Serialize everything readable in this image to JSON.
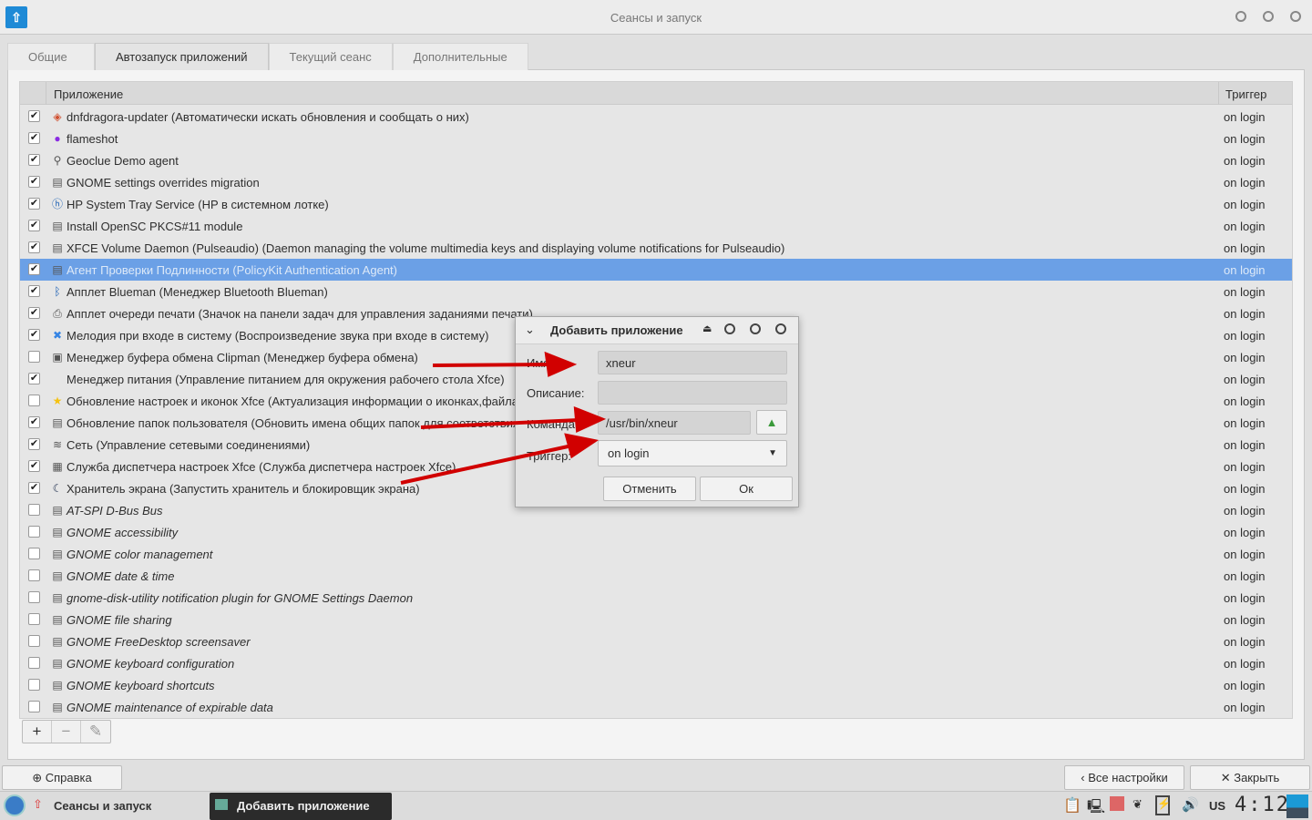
{
  "window": {
    "title": "Сеансы и запуск"
  },
  "tabs": [
    "Общие",
    "Автозапуск приложений",
    "Текущий сеанс",
    "Дополнительные"
  ],
  "table": {
    "headers": {
      "app": "Приложение",
      "trigger": "Триггер"
    },
    "rows": [
      {
        "checked": true,
        "icon": "dnfdragora-icon",
        "label": "dnfdragora-updater (Автоматически искать обновления и сообщать о них)",
        "trigger": "on login"
      },
      {
        "checked": true,
        "icon": "flameshot-icon",
        "label": "flameshot",
        "trigger": "on login"
      },
      {
        "checked": true,
        "icon": "location-pin-icon",
        "label": "Geoclue Demo agent",
        "trigger": "on login"
      },
      {
        "checked": true,
        "icon": "file-icon",
        "label": "GNOME settings overrides migration",
        "trigger": "on login"
      },
      {
        "checked": true,
        "icon": "hp-icon",
        "label": "HP System Tray Service (HP в системном лотке)",
        "trigger": "on login"
      },
      {
        "checked": true,
        "icon": "file-icon",
        "label": "Install OpenSC PKCS#11 module",
        "trigger": "on login"
      },
      {
        "checked": true,
        "icon": "file-icon",
        "label": "XFCE Volume Daemon (Pulseaudio) (Daemon managing the volume multimedia keys and displaying volume notifications for Pulseaudio)",
        "trigger": "on login"
      },
      {
        "checked": true,
        "icon": "file-icon",
        "label": "Агент Проверки Подлинности (PolicyKit Authentication Agent)",
        "trigger": "on login",
        "selected": true
      },
      {
        "checked": true,
        "icon": "bluetooth-icon",
        "label": "Апплет Blueman (Менеджер Bluetooth Blueman)",
        "trigger": "on login"
      },
      {
        "checked": true,
        "icon": "printer-icon",
        "label": "Апплет очереди печати (Значок на панели задач для управления заданиями печати)",
        "trigger": "on login"
      },
      {
        "checked": true,
        "icon": "sound-icon",
        "label": "Мелодия при входе в систему (Воспроизведение звука при входе в систему)",
        "trigger": "on login"
      },
      {
        "checked": false,
        "icon": "clipboard-icon",
        "label": "Менеджер буфера обмена Clipman (Менеджер буфера обмена)",
        "trigger": "on login"
      },
      {
        "checked": true,
        "icon": "",
        "label": "Менеджер питания (Управление питанием для окружения рабочего стола Xfce)",
        "trigger": "on login"
      },
      {
        "checked": false,
        "icon": "star-icon",
        "label": "Обновление настроек и иконок Xfce (Актуализация информации о иконках,файлах",
        "trigger": "on login"
      },
      {
        "checked": true,
        "icon": "file-icon",
        "label": "Обновление папок пользователя (Обновить имена общих папок для соответствия",
        "trigger": "on login"
      },
      {
        "checked": true,
        "icon": "wifi-icon",
        "label": "Сеть (Управление сетевыми соединениями)",
        "trigger": "on login"
      },
      {
        "checked": true,
        "icon": "settings-icon",
        "label": "Служба диспетчера настроек Xfce (Служба диспетчера настроек Xfce)",
        "trigger": "on login"
      },
      {
        "checked": true,
        "icon": "screensaver-icon",
        "label": "Хранитель экрана (Запустить хранитель и блокировщик экрана)",
        "trigger": "on login"
      },
      {
        "checked": false,
        "icon": "file-icon",
        "label": "AT-SPI D-Bus Bus",
        "trigger": "on login",
        "italic": true
      },
      {
        "checked": false,
        "icon": "file-icon",
        "label": "GNOME accessibility",
        "trigger": "on login",
        "italic": true
      },
      {
        "checked": false,
        "icon": "file-icon",
        "label": "GNOME color management",
        "trigger": "on login",
        "italic": true
      },
      {
        "checked": false,
        "icon": "file-icon",
        "label": "GNOME date & time",
        "trigger": "on login",
        "italic": true
      },
      {
        "checked": false,
        "icon": "file-icon",
        "label": "gnome-disk-utility notification plugin for GNOME Settings Daemon",
        "trigger": "on login",
        "italic": true
      },
      {
        "checked": false,
        "icon": "file-icon",
        "label": "GNOME file sharing",
        "trigger": "on login",
        "italic": true
      },
      {
        "checked": false,
        "icon": "file-icon",
        "label": "GNOME FreeDesktop screensaver",
        "trigger": "on login",
        "italic": true
      },
      {
        "checked": false,
        "icon": "file-icon",
        "label": "GNOME keyboard configuration",
        "trigger": "on login",
        "italic": true
      },
      {
        "checked": false,
        "icon": "file-icon",
        "label": "GNOME keyboard shortcuts",
        "trigger": "on login",
        "italic": true
      },
      {
        "checked": false,
        "icon": "file-icon",
        "label": "GNOME maintenance of expirable data",
        "trigger": "on login",
        "italic": true
      }
    ]
  },
  "toolbar": {
    "add": "+",
    "remove": "−",
    "edit": "✎"
  },
  "buttons": {
    "help": "Справка",
    "all_settings": "Все настройки",
    "close": "Закрыть"
  },
  "dialog": {
    "title": "Добавить приложение",
    "name_label": "Имя:",
    "name_value": "xneur",
    "desc_label": "Описание:",
    "desc_value": "",
    "cmd_label": "Команда:",
    "cmd_value": "/usr/bin/xneur",
    "trigger_label": "Триггер:",
    "trigger_value": "on login",
    "cancel": "Отменить",
    "ok": "Ок"
  },
  "taskbar": {
    "items": [
      "Сеансы и запуск",
      "Добавить приложение"
    ],
    "keyboard_layout": "US",
    "clock": "4:12"
  },
  "colors": {
    "selection": "#6ba0e6",
    "accent": "#1e8ad6",
    "arrow": "#d10000"
  }
}
